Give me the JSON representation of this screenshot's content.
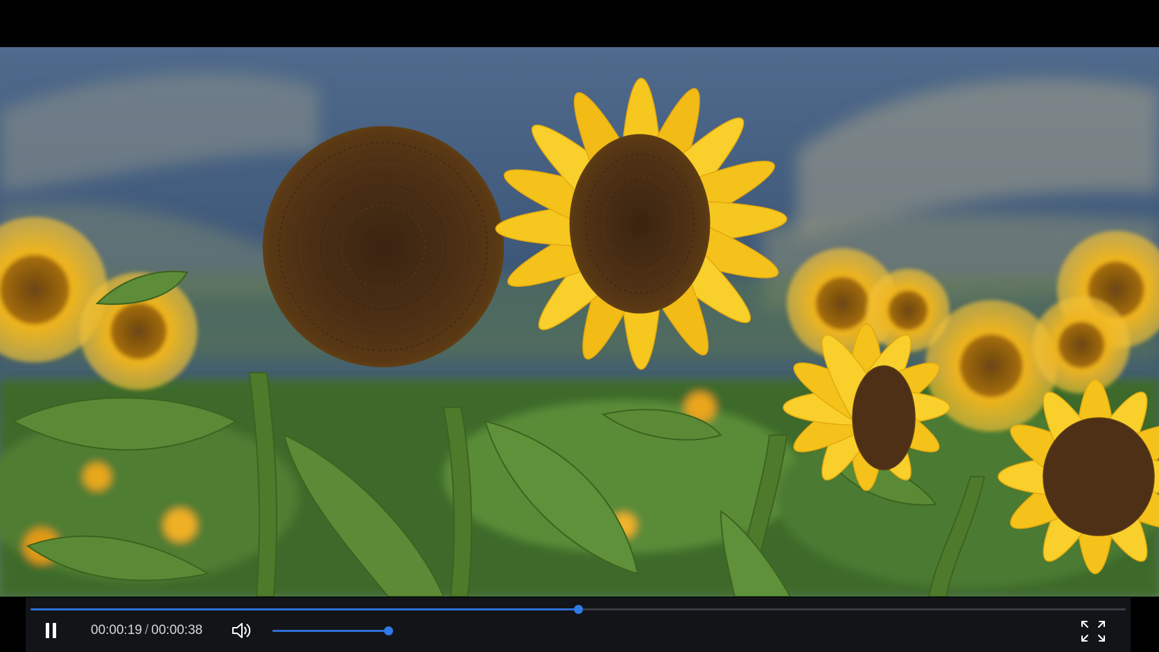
{
  "player": {
    "current_time": "00:00:19",
    "separator": "/",
    "duration": "00:00:38",
    "progress_fraction": 0.5,
    "volume_fraction": 0.97,
    "state": "playing",
    "accent_color": "#2f7be6"
  },
  "icons": {
    "play_pause": "pause-icon",
    "volume": "volume-icon",
    "fullscreen": "fullscreen-icon"
  }
}
